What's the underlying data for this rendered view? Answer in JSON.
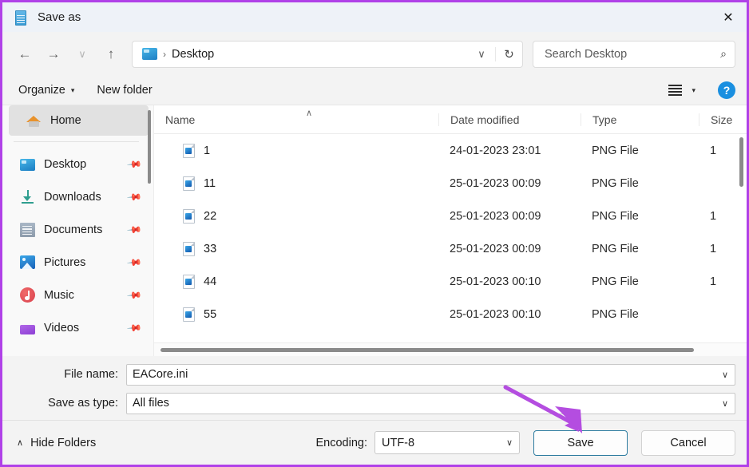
{
  "window": {
    "title": "Save as",
    "title_icon": "notepad-document-icon",
    "close_label": "✕",
    "border_color": "#b041e8"
  },
  "nav": {
    "back": "←",
    "forward": "→",
    "recent": "∨",
    "up": "↑",
    "breadcrumb_icon": "desktop-monitor-icon",
    "breadcrumb_separator": "›",
    "breadcrumb_text": "Desktop",
    "address_chevron": "∨",
    "refresh": "↻",
    "search_placeholder": "Search Desktop",
    "search_value": "",
    "search_icon": "magnifier-icon"
  },
  "commandbar": {
    "organize": "Organize",
    "organize_caret": "▾",
    "new_folder": "New folder",
    "view_icon": "list-view-icon",
    "view_caret": "▾",
    "help": "?"
  },
  "sidebar": {
    "selected": "Home",
    "items": [
      {
        "label": "Home",
        "icon": "home-icon",
        "pinned": false,
        "selected": true
      },
      {
        "label": "Desktop",
        "icon": "desktop-icon",
        "pinned": true,
        "selected": false
      },
      {
        "label": "Downloads",
        "icon": "downloads-icon",
        "pinned": true,
        "selected": false
      },
      {
        "label": "Documents",
        "icon": "documents-icon",
        "pinned": true,
        "selected": false
      },
      {
        "label": "Pictures",
        "icon": "pictures-icon",
        "pinned": true,
        "selected": false
      },
      {
        "label": "Music",
        "icon": "music-icon",
        "pinned": true,
        "selected": false
      },
      {
        "label": "Videos",
        "icon": "videos-icon",
        "pinned": true,
        "selected": false
      }
    ],
    "pin_glyph": "📌"
  },
  "filelist": {
    "columns": [
      "Name",
      "Date modified",
      "Type",
      "Size"
    ],
    "sort_column": "Name",
    "sort_caret": "∧",
    "rows": [
      {
        "name": "1",
        "date": "24-01-2023 23:01",
        "type": "PNG File",
        "size": "1"
      },
      {
        "name": "11",
        "date": "25-01-2023 00:09",
        "type": "PNG File",
        "size": ""
      },
      {
        "name": "22",
        "date": "25-01-2023 00:09",
        "type": "PNG File",
        "size": "1"
      },
      {
        "name": "33",
        "date": "25-01-2023 00:09",
        "type": "PNG File",
        "size": "1"
      },
      {
        "name": "44",
        "date": "25-01-2023 00:10",
        "type": "PNG File",
        "size": "1"
      },
      {
        "name": "55",
        "date": "25-01-2023 00:10",
        "type": "PNG File",
        "size": ""
      }
    ]
  },
  "form": {
    "file_name_label": "File name:",
    "file_name_value": "EACore.ini",
    "save_as_type_label": "Save as type:",
    "save_as_type_value": "All files",
    "chevron": "∨"
  },
  "footer": {
    "hide_folders_caret": "∧",
    "hide_folders": "Hide Folders",
    "encoding_label": "Encoding:",
    "encoding_value": "UTF-8",
    "encoding_chevron": "∨",
    "save": "Save",
    "cancel": "Cancel"
  },
  "annotation": {
    "arrow_color": "#b44de0",
    "points_to": "save-button"
  }
}
